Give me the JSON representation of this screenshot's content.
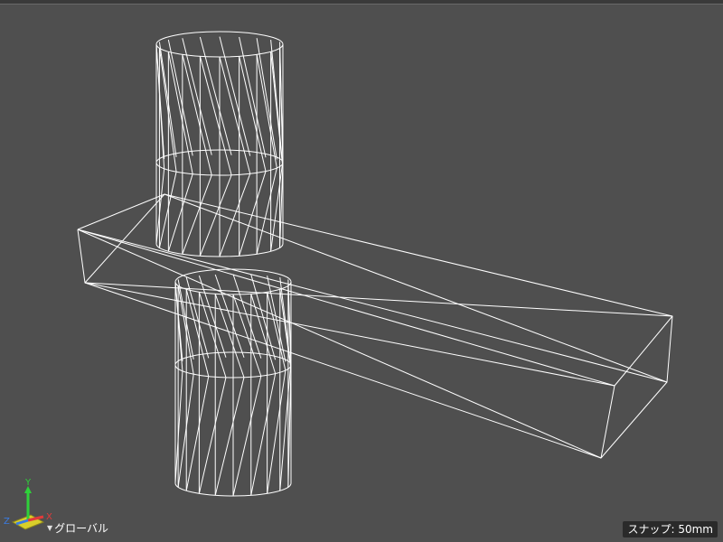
{
  "viewport": {
    "background": "#4f4f4f",
    "wire_color": "#ffffff"
  },
  "gizmo": {
    "y_label": "Y",
    "x_label": "X",
    "z_label": "Z",
    "y_color": "#2fd13a",
    "x_color": "#e23a3a",
    "z_color": "#3a7be2",
    "plane_color": "#d8cf2a"
  },
  "status": {
    "coord_system": "グローバル",
    "snap": "スナップ: 50mm"
  }
}
